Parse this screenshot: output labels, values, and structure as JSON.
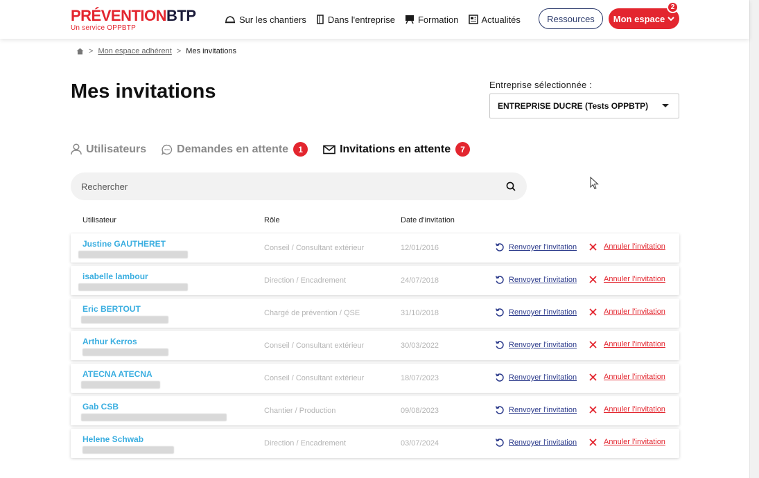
{
  "header": {
    "logo_part1": "PRÉVENTION",
    "logo_part2": "BTP",
    "logo_sub": "Un service OPPBTP",
    "nav": [
      {
        "label": "Sur les chantiers",
        "icon": "helmet-icon"
      },
      {
        "label": "Dans l'entreprise",
        "icon": "building-icon"
      },
      {
        "label": "Formation",
        "icon": "board-icon"
      },
      {
        "label": "Actualités",
        "icon": "news-icon"
      }
    ],
    "ressources_label": "Ressources",
    "espace_label": "Mon espace",
    "notif_count": "2"
  },
  "breadcrumb": {
    "parent": "Mon espace adhérent",
    "current": "Mes invitations"
  },
  "page_title": "Mes invitations",
  "company": {
    "label": "Entreprise sélectionnée :",
    "selected": "ENTREPRISE DUCRE (Tests OPPBTP)"
  },
  "tabs": [
    {
      "label": "Utilisateurs",
      "badge": null
    },
    {
      "label": "Demandes en attente",
      "badge": "1"
    },
    {
      "label": "Invitations en attente",
      "badge": "7"
    }
  ],
  "search": {
    "placeholder": "Rechercher"
  },
  "table": {
    "headers": [
      "Utilisateur",
      "Rôle",
      "Date d'invitation"
    ],
    "resend_label": "Renvoyer l'invitation",
    "cancel_label": "Annuler l'invitation",
    "rows": [
      {
        "name": "Justine GAUTHERET",
        "role": "Conseil / Consultant extérieur",
        "date": "12/01/2016"
      },
      {
        "name": "isabelle lambour",
        "role": "Direction / Encadrement",
        "date": "24/07/2018"
      },
      {
        "name": "Eric BERTOUT",
        "role": "Chargé de prévention / QSE",
        "date": "31/10/2018"
      },
      {
        "name": "Arthur Kerros",
        "role": "Conseil / Consultant extérieur",
        "date": "30/03/2022"
      },
      {
        "name": "ATECNA ATECNA",
        "role": "Conseil / Consultant extérieur",
        "date": "18/07/2023"
      },
      {
        "name": "Gab CSB",
        "role": "Chantier / Production",
        "date": "09/08/2023"
      },
      {
        "name": "Helene Schwab",
        "role": "Direction / Encadrement",
        "date": "03/07/2024"
      }
    ]
  },
  "colors": {
    "brand_red": "#e3262f",
    "brand_navy": "#2b3a6b",
    "link_blue": "#3aaee0"
  }
}
